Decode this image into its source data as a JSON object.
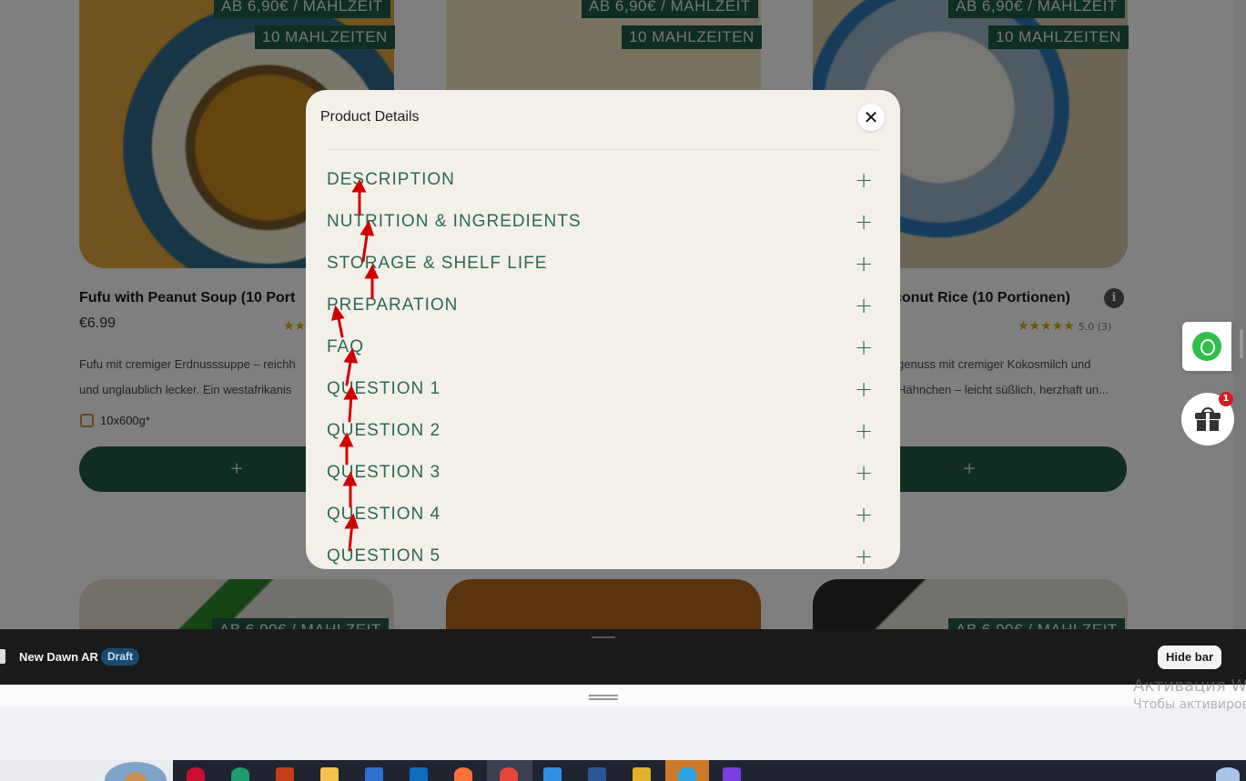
{
  "store": {
    "products": [
      {
        "tag_price": "AB 6,90€ / MAHLZEIT",
        "tag_meals": "10 MAHLZEITEN",
        "title": "Fufu with Peanut Soup (10 Port",
        "price": "€6.99",
        "stars": "★★",
        "desc_line1": "Fufu mit cremiger Erdnusssuppe – reichh",
        "desc_line2": "und unglaublich lecker. Ein westafrikanis",
        "portion": "10x600g*",
        "add_label": "+"
      },
      {
        "tag_price": "AB 6,90€ / MAHLZEIT",
        "tag_meals": "10 MAHLZEITEN"
      },
      {
        "tag_price": "AB 6,90€ / MAHLZEIT",
        "tag_meals": "10 MAHLZEITEN",
        "title": "conut Rice (10 Portionen)",
        "info_icon": "i",
        "stars": "★★★★★",
        "rating": "5.0 (3)",
        "desc_line1": "genuss mit cremiger Kokosmilch und",
        "desc_line2": "Hähnchen – leicht süßlich, herzhaft un...",
        "add_label": "+"
      }
    ],
    "row2_tags": [
      "AB 6,90€ / MAHLZEIT",
      "AB 6,90€ / MAHLZEIT"
    ],
    "gift_badge": "1",
    "icons": {
      "whatsapp": "whatsapp-icon",
      "gift": "gift-icon",
      "close": "close-icon",
      "plus": "plus-icon"
    }
  },
  "modal": {
    "title": "Product Details",
    "close_label": "✕",
    "items": [
      {
        "label": "DESCRIPTION",
        "toggle": "+"
      },
      {
        "label": "NUTRITION & INGREDIENTS",
        "toggle": "+"
      },
      {
        "label": "STORAGE & SHELF LIFE",
        "toggle": "+"
      },
      {
        "label": "PREPARATION",
        "toggle": "+"
      },
      {
        "label": "FAQ",
        "toggle": "+"
      },
      {
        "label": "QUESTION 1",
        "toggle": "+"
      },
      {
        "label": "QUESTION 2",
        "toggle": "+"
      },
      {
        "label": "QUESTION 3",
        "toggle": "+"
      },
      {
        "label": "QUESTION 4",
        "toggle": "+"
      },
      {
        "label": "QUESTION 5",
        "toggle": "+"
      }
    ]
  },
  "preview_bar": {
    "theme_name": "New Dawn AR",
    "status": "Draft",
    "hide_label": "Hide bar"
  },
  "watermark": {
    "line1": "Активация W",
    "line2": "Чтобы активиров"
  },
  "colors": {
    "brand_green": "#1e5b44",
    "accordion_text": "#2c6a52",
    "modal_bg": "#f3efe9",
    "star": "#e0a800",
    "annotation_arrow": "#d10000"
  }
}
